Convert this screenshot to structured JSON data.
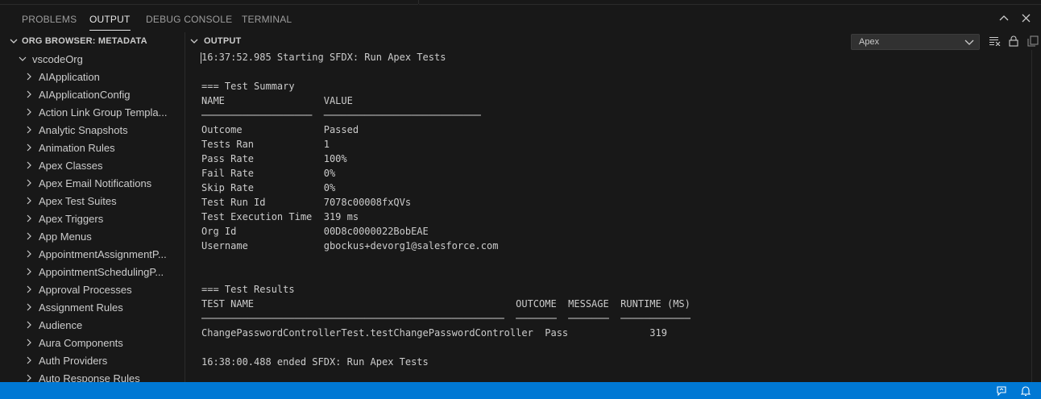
{
  "panel_tabs": [
    "PROBLEMS",
    "OUTPUT",
    "DEBUG CONSOLE",
    "TERMINAL"
  ],
  "active_tab": "OUTPUT",
  "sidebar": {
    "title": "ORG BROWSER: METADATA",
    "org": "vscodeOrg",
    "items": [
      "AIApplication",
      "AIApplicationConfig",
      "Action Link Group Templa...",
      "Analytic Snapshots",
      "Animation Rules",
      "Apex Classes",
      "Apex Email Notifications",
      "Apex Test Suites",
      "Apex Triggers",
      "App Menus",
      "AppointmentAssignmentP...",
      "AppointmentSchedulingP...",
      "Approval Processes",
      "Assignment Rules",
      "Audience",
      "Aura Components",
      "Auth Providers",
      "Auto Response Rules"
    ]
  },
  "output": {
    "title": "OUTPUT",
    "channel": "Apex",
    "log_lines": [
      "16:37:52.985 Starting SFDX: Run Apex Tests",
      "",
      "=== Test Summary",
      "NAME                 VALUE",
      "───────────────────  ───────────────────────────",
      "Outcome              Passed",
      "Tests Ran            1",
      "Pass Rate            100%",
      "Fail Rate            0%",
      "Skip Rate            0%",
      "Test Run Id          7078c00008fxQVs",
      "Test Execution Time  319 ms",
      "Org Id               00D8c0000022BobEAE",
      "Username             gbockus+devorg1@salesforce.com",
      "",
      "",
      "=== Test Results",
      "TEST NAME                                             OUTCOME  MESSAGE  RUNTIME (MS)",
      "────────────────────────────────────────────────────  ───────  ───────  ────────────",
      "ChangePasswordControllerTest.testChangePasswordController  Pass              319",
      "",
      "16:38:00.488 ended SFDX: Run Apex Tests"
    ]
  },
  "colors": {
    "background": "#181818",
    "statusbar": "#0078d4",
    "text": "#cccccc",
    "border": "#2b2b2b"
  },
  "icons": [
    "maximize-panel-icon",
    "close-panel-icon",
    "clear-output-icon",
    "lock-scroll-icon",
    "open-output-editor-icon",
    "feedback-icon",
    "notifications-bell-icon"
  ]
}
